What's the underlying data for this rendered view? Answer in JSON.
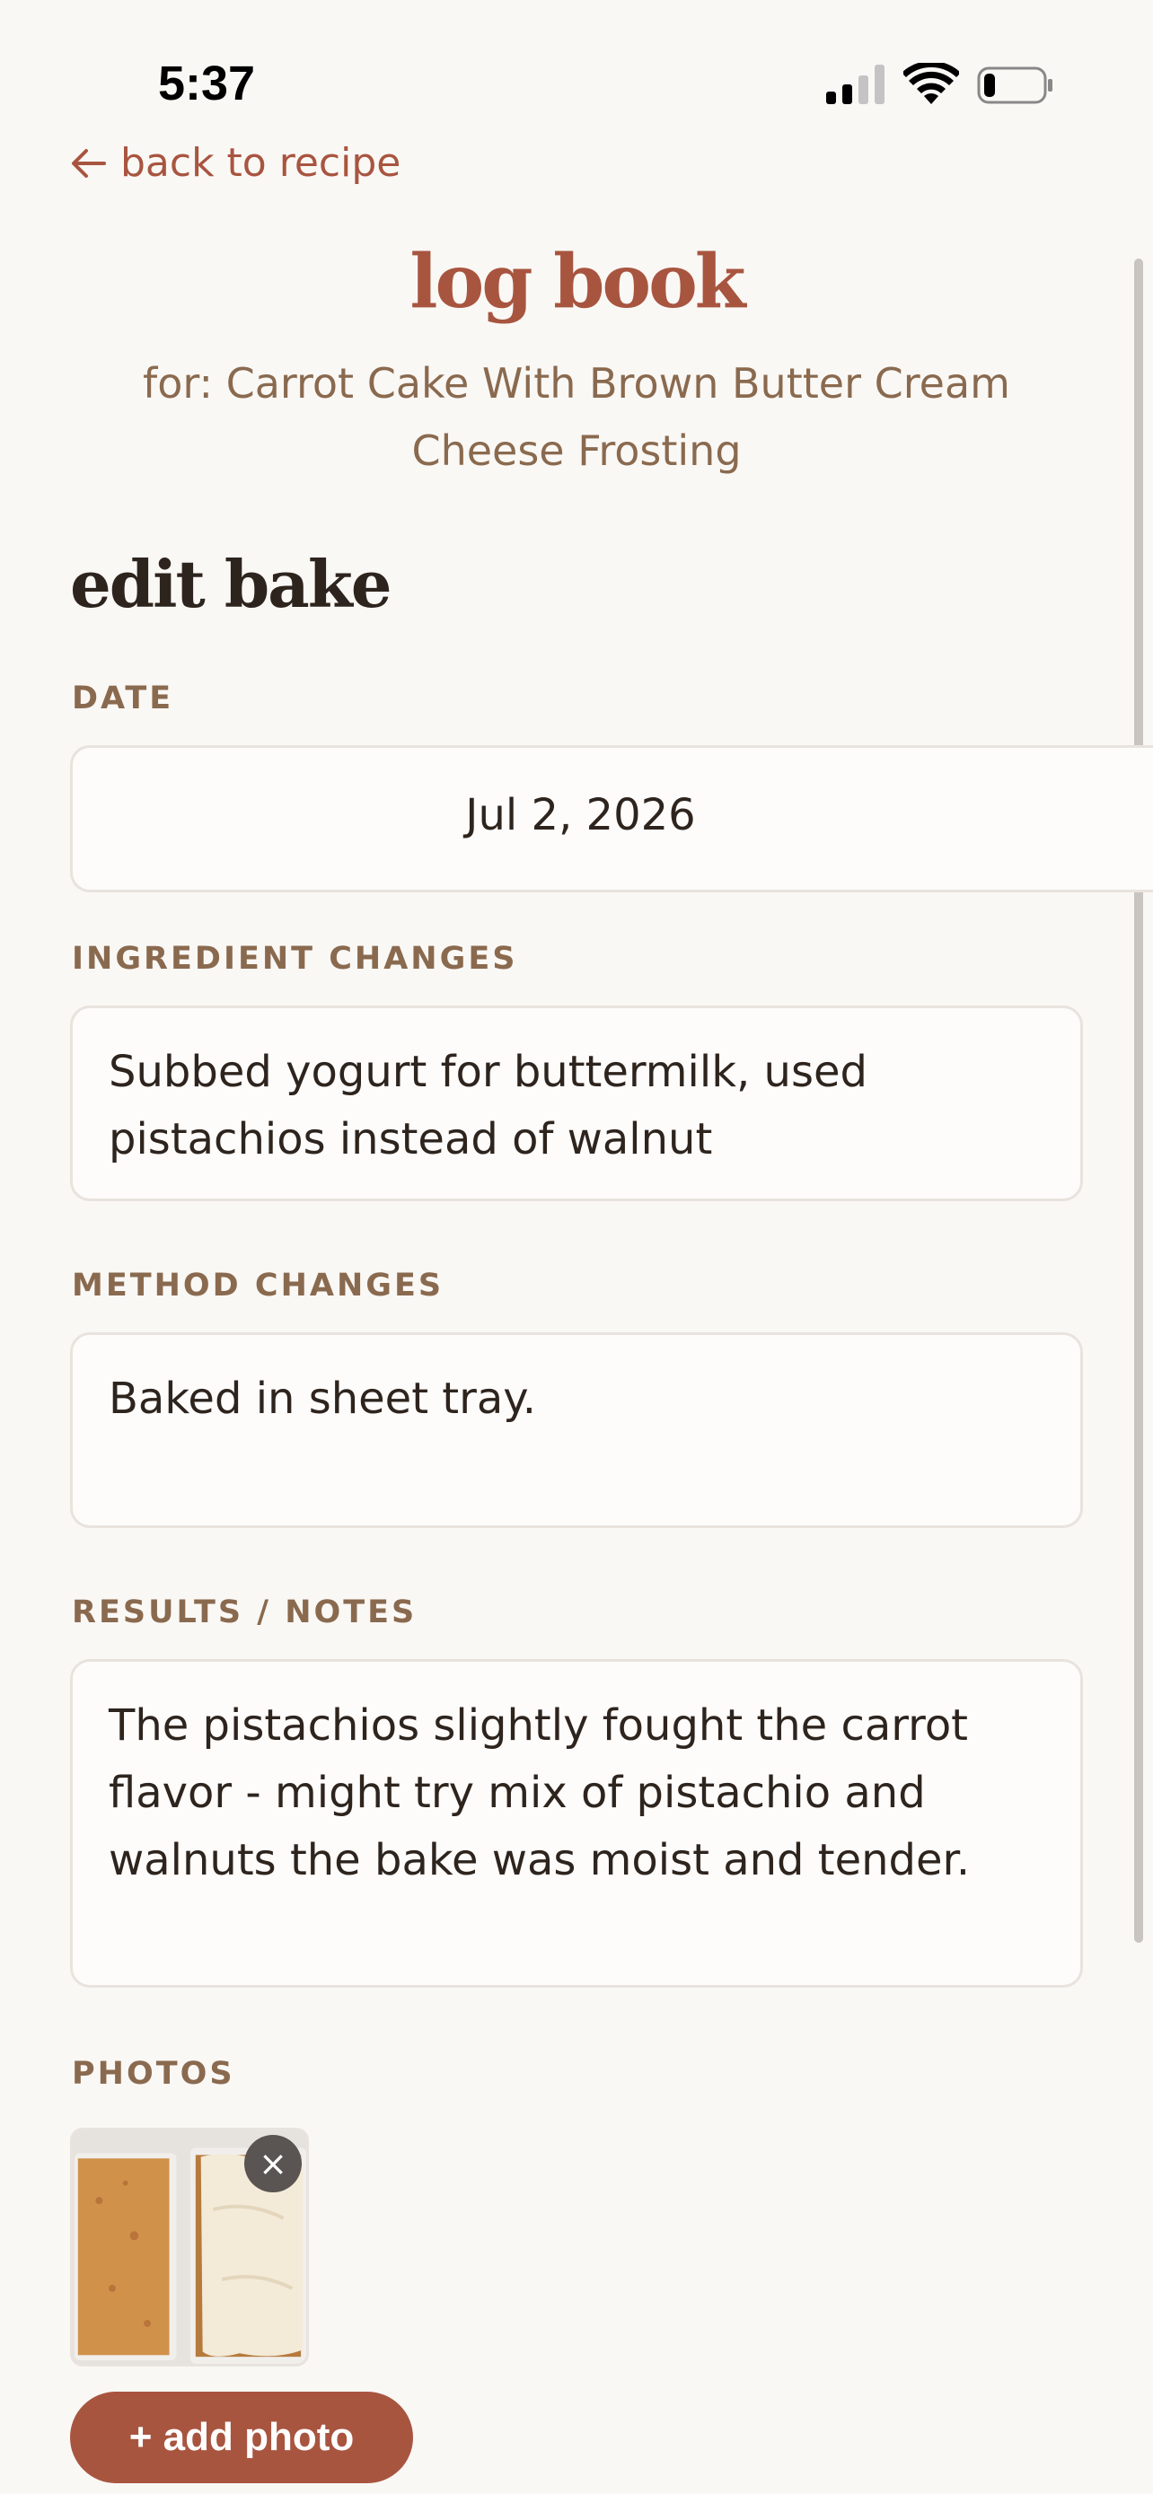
{
  "status_bar": {
    "time": "5:37"
  },
  "nav": {
    "back_label": "back to recipe"
  },
  "header": {
    "title": "log book",
    "subtitle": "for: Carrot Cake With Brown Butter Cream Cheese Frosting"
  },
  "form": {
    "heading": "edit bake",
    "date_label": "DATE",
    "date_value": "Jul 2, 2026",
    "ingredient_label": "INGREDIENT CHANGES",
    "ingredient_value": "Subbed yogurt for buttermilk, used pistachios instead of walnut",
    "method_label": "METHOD CHANGES",
    "method_value": "Baked in sheet tray.",
    "notes_label": "RESULTS / NOTES",
    "notes_value": "The pistachios slightly fought the carrot flavor - might try mix of pistachio and walnuts the bake was moist and tender.",
    "photos_label": "PHOTOS",
    "remove_photo_glyph": "×",
    "add_photo_label": "+ add photo"
  },
  "colors": {
    "accent": "#a85540",
    "label": "#8a6a4f",
    "text": "#2e241e",
    "background": "#faf8f5"
  },
  "icons": [
    "back-arrow-icon",
    "cellular-signal-icon",
    "wifi-icon",
    "battery-icon",
    "close-icon"
  ]
}
